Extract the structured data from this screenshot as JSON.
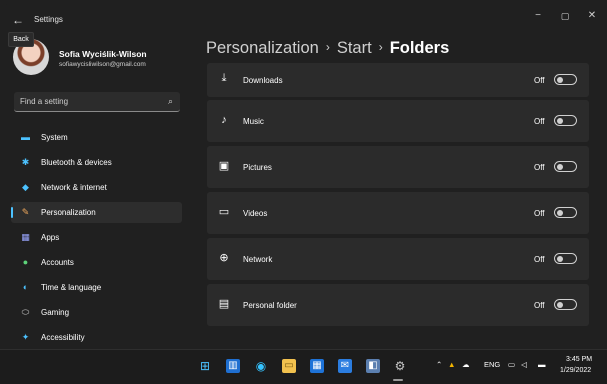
{
  "window": {
    "app_title": "Settings",
    "back_tooltip": "Back",
    "minimize": "−",
    "maximize": "▢",
    "close": "✕"
  },
  "profile": {
    "name": "Sofia Wyciślik-Wilson",
    "email": "sofiawycisliwilson@gmail.com"
  },
  "search": {
    "placeholder": "Find a setting",
    "icon": "search-icon"
  },
  "nav": {
    "items": [
      {
        "label": "System",
        "icon": "monitor-icon",
        "color": "#4cc2ff"
      },
      {
        "label": "Bluetooth & devices",
        "icon": "bluetooth-icon",
        "color": "#4cc2ff"
      },
      {
        "label": "Network & internet",
        "icon": "wifi-icon",
        "color": "#4cc2ff"
      },
      {
        "label": "Personalization",
        "icon": "brush-icon",
        "color": "#f0a95c",
        "active": true
      },
      {
        "label": "Apps",
        "icon": "apps-icon",
        "color": "#9aa6ff"
      },
      {
        "label": "Accounts",
        "icon": "person-icon",
        "color": "#5dd37a"
      },
      {
        "label": "Time & language",
        "icon": "globe-clock-icon",
        "color": "#4cc2ff"
      },
      {
        "label": "Gaming",
        "icon": "gamepad-icon",
        "color": "#c4c4c4"
      },
      {
        "label": "Accessibility",
        "icon": "accessibility-icon",
        "color": "#4cc2ff"
      }
    ]
  },
  "header": {
    "crumb1": "Personalization",
    "crumb2": "Start",
    "current": "Folders",
    "separator": "›"
  },
  "folders": [
    {
      "label": "Downloads",
      "state": "Off",
      "icon": "download-icon"
    },
    {
      "label": "Music",
      "state": "Off",
      "icon": "music-icon"
    },
    {
      "label": "Pictures",
      "state": "Off",
      "icon": "pictures-icon"
    },
    {
      "label": "Videos",
      "state": "Off",
      "icon": "video-icon"
    },
    {
      "label": "Network",
      "state": "Off",
      "icon": "network-icon"
    },
    {
      "label": "Personal folder",
      "state": "Off",
      "icon": "personal-folder-icon"
    }
  ],
  "taskbar": {
    "language": "ENG",
    "time": "3:45 PM",
    "date": "1/29/2022"
  },
  "colors": {
    "accent": "#4cc2ff",
    "window_bg": "#202020",
    "card_bg": "#2b2b2b"
  }
}
